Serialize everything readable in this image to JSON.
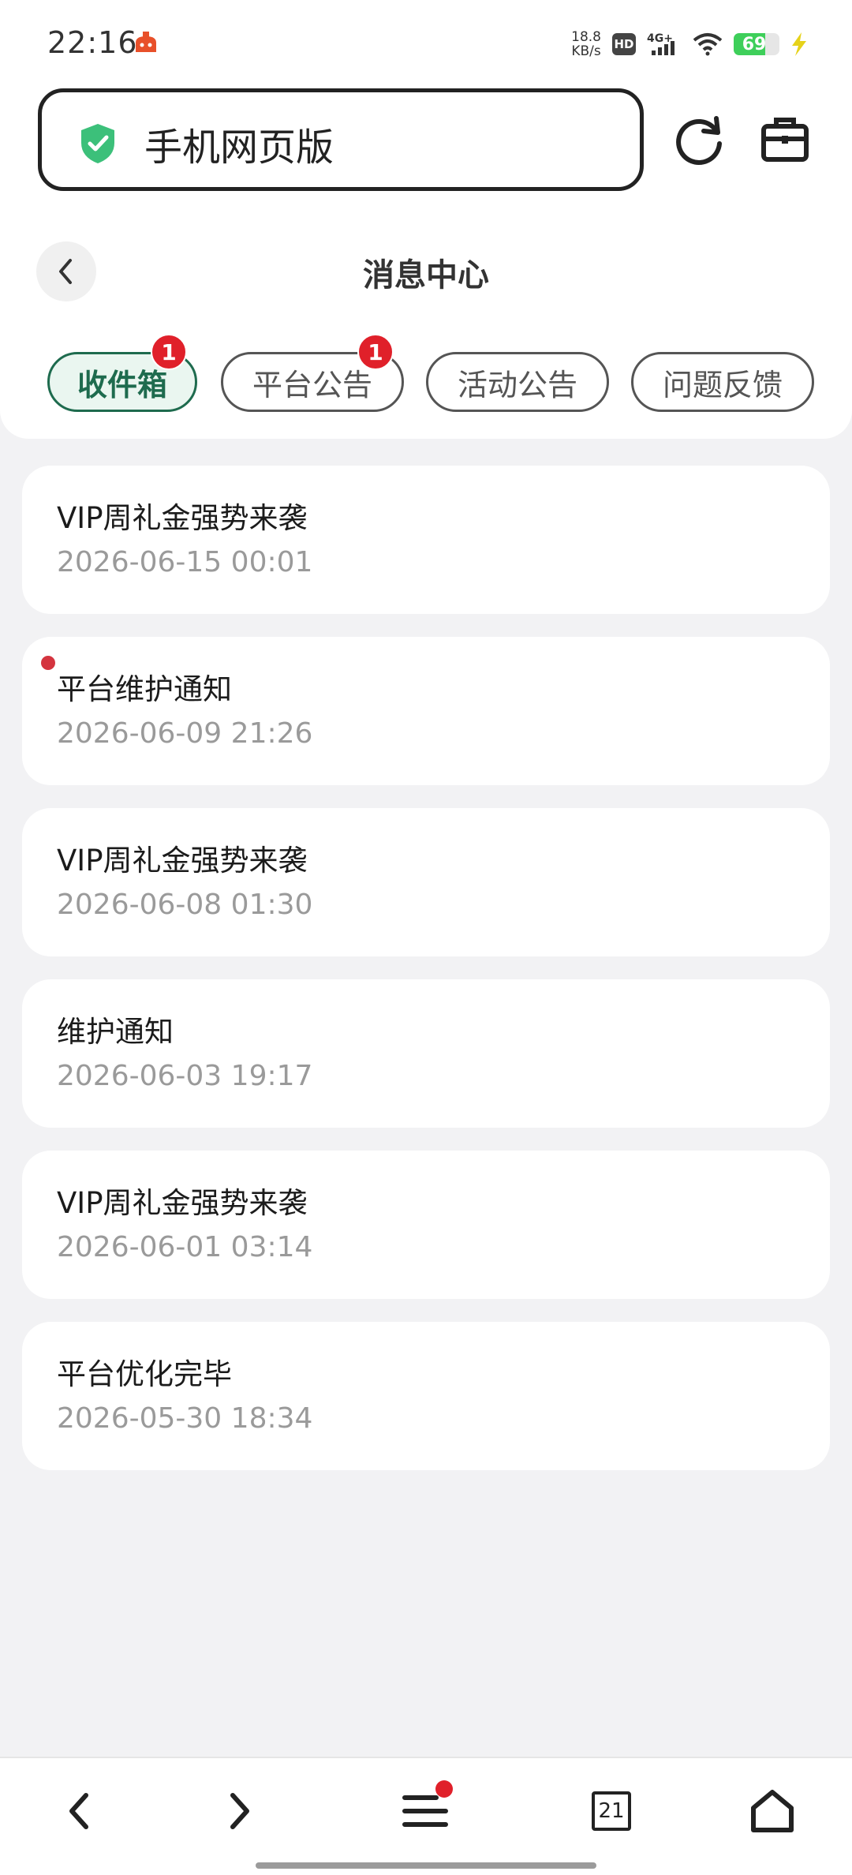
{
  "status_bar": {
    "time": "22:16",
    "net_speed_value": "18.8",
    "net_speed_unit": "KB/s",
    "hd_badge": "HD",
    "network_type": "4G+",
    "battery_percent": "69",
    "battery_level": 0.69
  },
  "browser": {
    "address_text": "手机网页版",
    "shield_color": "#3cc07a"
  },
  "page": {
    "title": "消息中心"
  },
  "tabs": [
    {
      "label": "收件箱",
      "badge": "1",
      "active": true
    },
    {
      "label": "平台公告",
      "badge": "1",
      "active": false
    },
    {
      "label": "活动公告",
      "badge": "",
      "active": false
    },
    {
      "label": "问题反馈",
      "badge": "",
      "active": false
    }
  ],
  "messages": [
    {
      "title": "VIP周礼金强势来袭",
      "date": "2026-06-15 00:01",
      "unread": false
    },
    {
      "title": "平台维护通知",
      "date": "2026-06-09 21:26",
      "unread": true
    },
    {
      "title": "VIP周礼金强势来袭",
      "date": "2026-06-08 01:30",
      "unread": false
    },
    {
      "title": "维护通知",
      "date": "2026-06-03 19:17",
      "unread": false
    },
    {
      "title": "VIP周礼金强势来袭",
      "date": "2026-06-01 03:14",
      "unread": false
    },
    {
      "title": "平台优化完毕",
      "date": "2026-05-30 18:34",
      "unread": false
    }
  ],
  "bottom_nav": {
    "back_icon": "chevron-left-icon",
    "forward_icon": "chevron-right-icon",
    "menu_icon": "menu-icon",
    "tab_count": "21",
    "home_icon": "home-icon"
  },
  "colors": {
    "accent": "#1e6b4e",
    "badge": "#e0202a",
    "unread_dot": "#d4343f",
    "background": "#f2f2f4"
  }
}
